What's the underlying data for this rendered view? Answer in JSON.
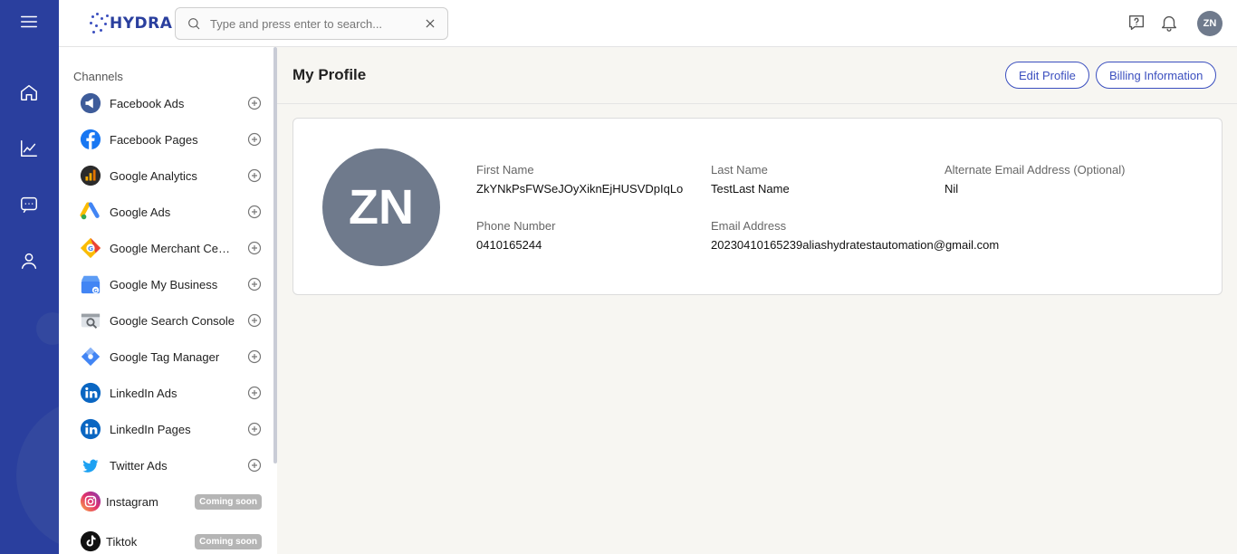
{
  "app": {
    "logo_text": "HYDRA"
  },
  "rail": {
    "items": [
      {
        "name": "home",
        "icon": "home-icon"
      },
      {
        "name": "analytics",
        "icon": "chart-line-icon"
      },
      {
        "name": "messages",
        "icon": "chat-icon"
      },
      {
        "name": "profile",
        "icon": "user-icon"
      }
    ]
  },
  "search": {
    "placeholder": "Type and press enter to search...",
    "value": ""
  },
  "header": {
    "avatar_initials": "ZN",
    "icons": [
      "help-icon",
      "bell-icon"
    ]
  },
  "sidebar": {
    "heading": "Channels",
    "channels": [
      {
        "label": "Facebook Ads",
        "status": "add"
      },
      {
        "label": "Facebook Pages",
        "status": "add"
      },
      {
        "label": "Google Analytics",
        "status": "add"
      },
      {
        "label": "Google Ads",
        "status": "add"
      },
      {
        "label": "Google Merchant Center",
        "status": "add"
      },
      {
        "label": "Google My Business",
        "status": "add"
      },
      {
        "label": "Google Search Console",
        "status": "add"
      },
      {
        "label": "Google Tag Manager",
        "status": "add"
      },
      {
        "label": "LinkedIn Ads",
        "status": "add"
      },
      {
        "label": "LinkedIn Pages",
        "status": "add"
      },
      {
        "label": "Twitter Ads",
        "status": "add"
      },
      {
        "label": "Instagram",
        "status": "Coming soon"
      },
      {
        "label": "Tiktok",
        "status": "Coming soon"
      }
    ]
  },
  "main": {
    "title": "My Profile",
    "edit_label": "Edit Profile",
    "billing_label": "Billing Information",
    "avatar_initials": "ZN",
    "fields": {
      "first_name_label": "First Name",
      "first_name": "ZkYNkPsFWSeJOyXiknEjHUSVDpIqLo",
      "last_name_label": "Last Name",
      "last_name": "TestLast Name",
      "alt_email_label": "Alternate Email Address (Optional)",
      "alt_email": "Nil",
      "phone_label": "Phone Number",
      "phone": "0410165244",
      "email_label": "Email Address",
      "email": "20230410165239aliashydratestautomation@gmail.com"
    }
  },
  "colors": {
    "rail": "#2a3f9e",
    "accent": "#3b4fbf",
    "avatar": "#6f7a8c",
    "badge": "#b5b5b5"
  }
}
